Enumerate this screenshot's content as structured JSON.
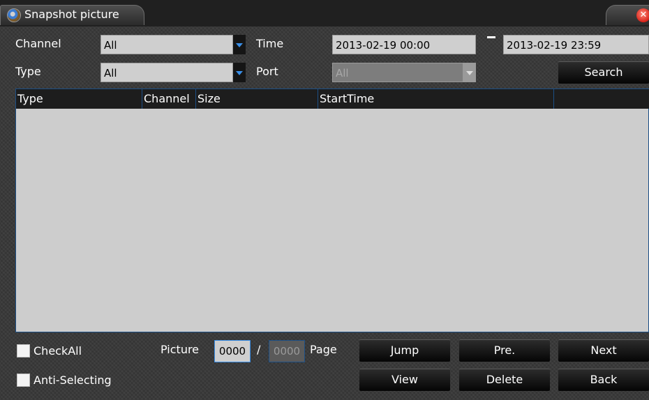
{
  "window": {
    "title": "Snapshot picture",
    "close_glyph": "✕"
  },
  "filters": {
    "channel_label": "Channel",
    "channel_value": "All",
    "type_label": "Type",
    "type_value": "All",
    "time_label": "Time",
    "time_start": "2013-02-19 00:00",
    "time_end": "2013-02-19 23:59",
    "port_label": "Port",
    "port_value": "All",
    "search_label": "Search"
  },
  "table": {
    "columns": [
      "Type",
      "Channel",
      "Size",
      "StartTime",
      ""
    ],
    "rows": []
  },
  "footer": {
    "check_all_label": "CheckAll",
    "anti_selecting_label": "Anti-Selecting",
    "picture_label": "Picture",
    "current_page": "0000",
    "separator": "/",
    "total_pages": "0000",
    "page_label": "Page",
    "jump_label": "Jump",
    "prev_label": "Pre.",
    "next_label": "Next",
    "view_label": "View",
    "delete_label": "Delete",
    "back_label": "Back"
  },
  "colors": {
    "accent": "#3a8fe8",
    "table_border": "#1c4f86",
    "close": "#d8231a"
  }
}
